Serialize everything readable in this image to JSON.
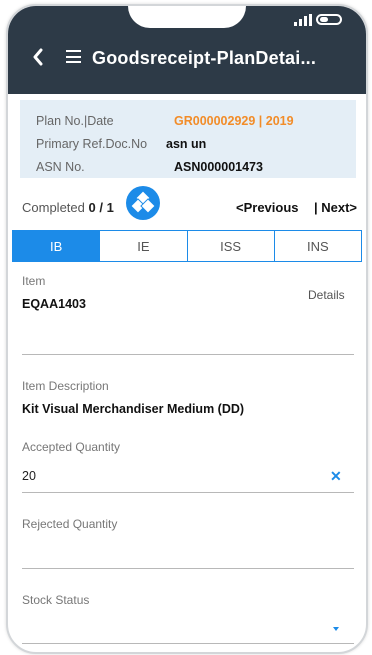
{
  "header": {
    "title": "Goodsreceipt-PlanDetai..."
  },
  "info": {
    "plan_label": "Plan No.|Date",
    "plan_value": "GR000002929 | 2019",
    "ref_label": "Primary Ref.Doc.No",
    "ref_value": "asn un",
    "asn_label": "ASN No.",
    "asn_value": "ASN000001473"
  },
  "progress": {
    "completed_label": "Completed",
    "completed_value": "0 / 1",
    "previous_label": "<Previous",
    "next_label": "| Next>"
  },
  "tabs": [
    {
      "label": "IB"
    },
    {
      "label": "IE"
    },
    {
      "label": "ISS"
    },
    {
      "label": "INS"
    }
  ],
  "form": {
    "item_label": "Item",
    "item_value": "EQAA1403",
    "details_label": "Details",
    "desc_label": "Item Description",
    "desc_value": "Kit Visual Merchandiser Medium (DD)",
    "accepted_label": "Accepted Quantity",
    "accepted_value": "20",
    "rejected_label": "Rejected Quantity",
    "rejected_value": "",
    "stock_label": "Stock Status",
    "stock_value": ""
  },
  "colors": {
    "header_bg": "#2d3a47",
    "accent": "#1c8be8",
    "highlight": "#f28c28",
    "info_bg": "#e4eef6"
  },
  "icons": {
    "back": "back-arrow-icon",
    "menu": "hamburger-menu-icon",
    "cube": "cubes-icon",
    "clear": "clear-x-icon",
    "dropdown": "dropdown-caret-icon"
  }
}
